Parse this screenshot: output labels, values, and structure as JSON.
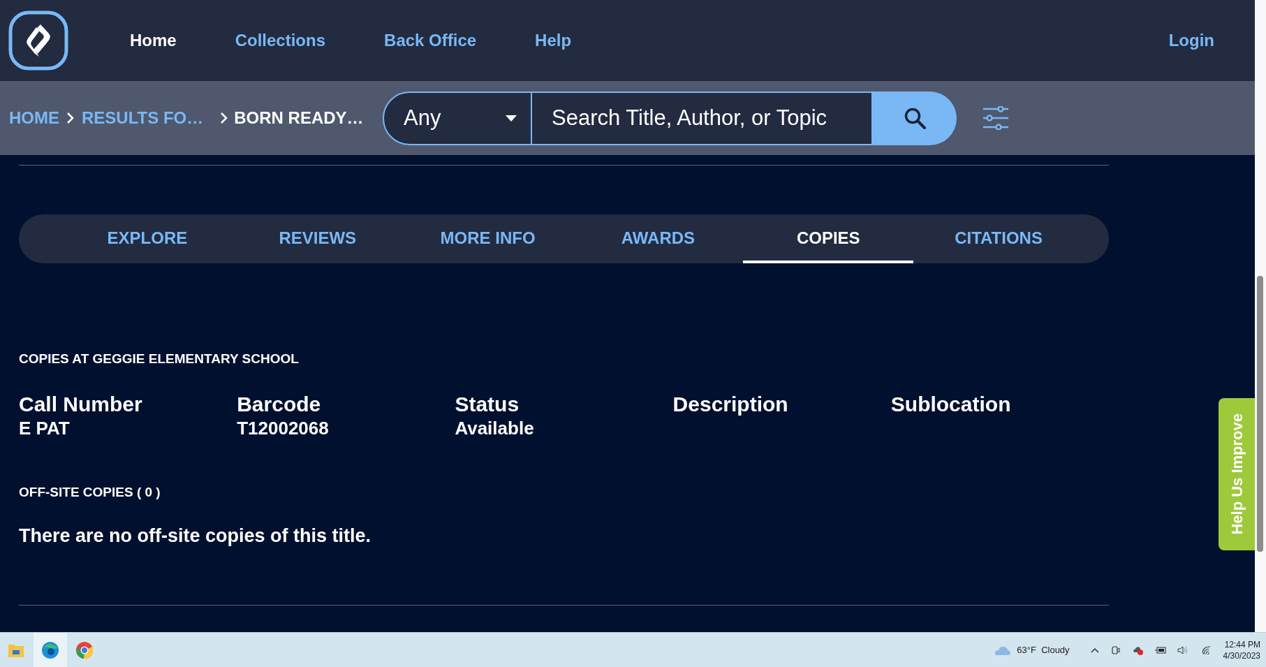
{
  "nav": {
    "items": [
      {
        "label": "Home",
        "selected": true
      },
      {
        "label": "Collections",
        "selected": false
      },
      {
        "label": "Back Office",
        "selected": false
      },
      {
        "label": "Help",
        "selected": false
      }
    ],
    "login": "Login"
  },
  "breadcrumbs": [
    {
      "label": "HOME",
      "current": false
    },
    {
      "label": "RESULTS FO…",
      "current": false
    },
    {
      "label": "BORN READY…",
      "current": true
    }
  ],
  "search": {
    "scope": "Any",
    "placeholder": "Search Title, Author, or Topic"
  },
  "tabs": [
    {
      "label": "EXPLORE",
      "selected": false
    },
    {
      "label": "REVIEWS",
      "selected": false
    },
    {
      "label": "MORE INFO",
      "selected": false
    },
    {
      "label": "AWARDS",
      "selected": false
    },
    {
      "label": "COPIES",
      "selected": true
    },
    {
      "label": "CITATIONS",
      "selected": false
    }
  ],
  "copies": {
    "heading": "COPIES AT GEGGIE ELEMENTARY SCHOOL",
    "columns": [
      {
        "header": "Call Number",
        "value": "E PAT"
      },
      {
        "header": "Barcode",
        "value": "T12002068"
      },
      {
        "header": "Status",
        "value": "Available"
      },
      {
        "header": "Description"
      },
      {
        "header": "Sublocation"
      }
    ]
  },
  "offsite": {
    "heading": "OFF-SITE COPIES ( 0 )",
    "message": "There are no off-site copies of this title."
  },
  "feedback_tab": "Help Us Improve",
  "taskbar": {
    "weather": "63°F  Cloudy",
    "time": "12:44 PM",
    "date": "4/30/2023"
  }
}
